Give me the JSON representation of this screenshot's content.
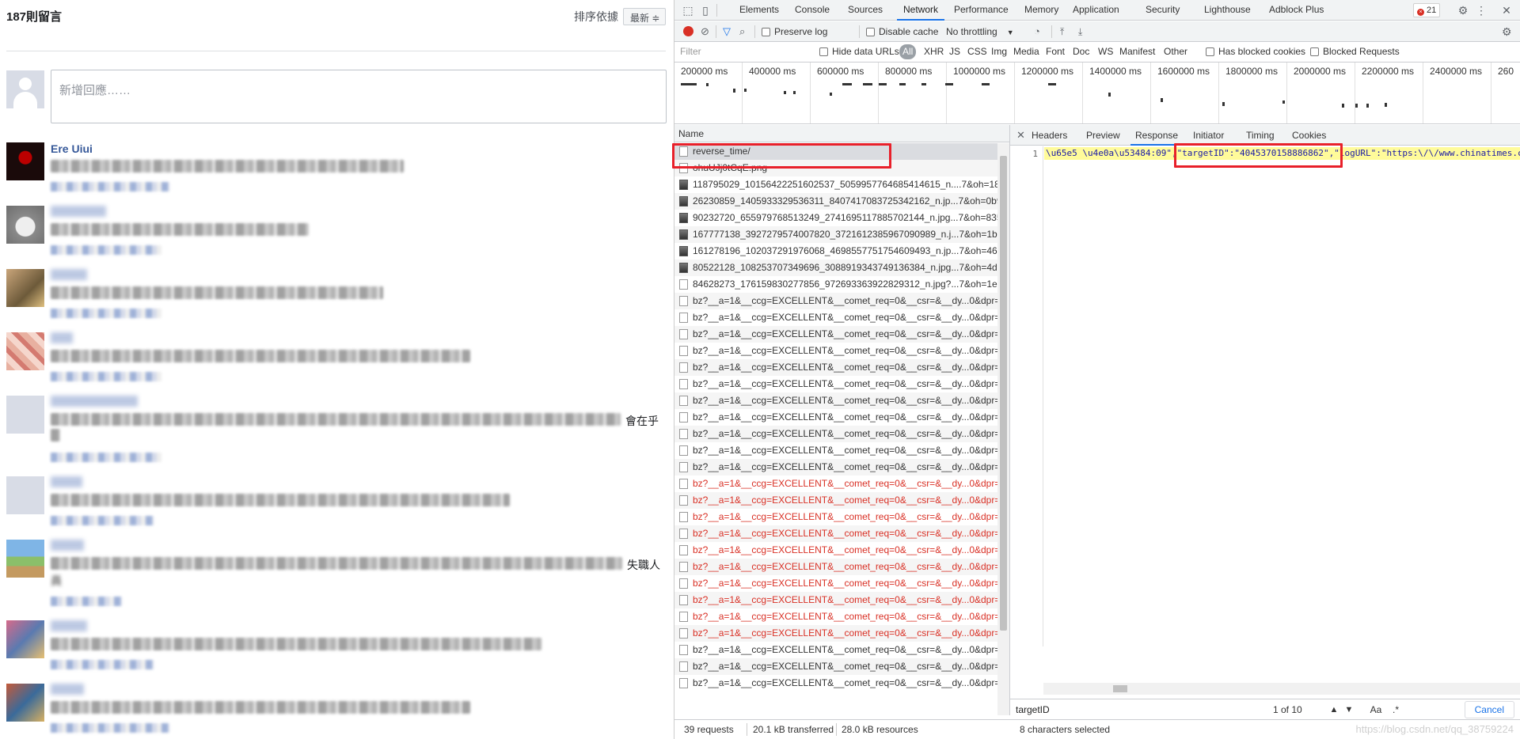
{
  "comments_panel": {
    "count_label": "187則留言",
    "sort_label": "排序依據",
    "sort_value": "最新 ≑",
    "input_placeholder": "新增回應……",
    "first_commenter": "Ere Uiui",
    "tail_text_1": "會在乎",
    "tail_text_2": "失職人",
    "tail_text_3": "員"
  },
  "devtools": {
    "tabs": [
      "Elements",
      "Console",
      "Sources",
      "Network",
      "Performance",
      "Memory",
      "Application",
      "Security",
      "Lighthouse",
      "Adblock Plus"
    ],
    "active_tab": "Network",
    "error_count": "21",
    "toolbar": {
      "preserve_log": "Preserve log",
      "disable_cache": "Disable cache",
      "throttling": "No throttling"
    },
    "filter": {
      "placeholder": "Filter",
      "hide_data_urls": "Hide data URLs",
      "types": [
        "All",
        "XHR",
        "JS",
        "CSS",
        "Img",
        "Media",
        "Font",
        "Doc",
        "WS",
        "Manifest",
        "Other"
      ],
      "has_blocked_cookies": "Has blocked cookies",
      "blocked_requests": "Blocked Requests"
    },
    "overview_labels": [
      "200000 ms",
      "400000 ms",
      "600000 ms",
      "800000 ms",
      "1000000 ms",
      "1200000 ms",
      "1400000 ms",
      "1600000 ms",
      "1800000 ms",
      "2000000 ms",
      "2200000 ms",
      "2400000 ms",
      "260"
    ],
    "names_header": "Name",
    "requests": [
      {
        "name": "reverse_time/",
        "kind": "doc",
        "status": "selected"
      },
      {
        "name": "ohuUJj0tCqE.png",
        "kind": "doc",
        "status": "normal"
      },
      {
        "name": "118795029_10156422251602537_5059957764685414615_n....7&oh=1891",
        "kind": "img",
        "status": "normal"
      },
      {
        "name": "26230859_1405933329536311_8407417083725342162_n.jp...7&oh=0b95",
        "kind": "img",
        "status": "normal"
      },
      {
        "name": "90232720_655979768513249_2741695117885702144_n.jpg...7&oh=8359",
        "kind": "img",
        "status": "normal"
      },
      {
        "name": "167777138_3927279574007820_3721612385967090989_n.j...7&oh=1b20",
        "kind": "img",
        "status": "normal"
      },
      {
        "name": "161278196_102037291976068_4698557751754609493_n.jp...7&oh=4628",
        "kind": "img",
        "status": "normal"
      },
      {
        "name": "80522128_108253707349696_3088919343749136384_n.jpg...7&oh=4dfa",
        "kind": "img",
        "status": "normal"
      },
      {
        "name": "84628273_176159830277856_972693363922829312_n.jpg?...7&oh=1e51",
        "kind": "doc",
        "status": "normal"
      },
      {
        "name": "bz?__a=1&__ccg=EXCELLENT&__comet_req=0&__csr=&__dy...0&dpr=1&",
        "kind": "doc",
        "status": "normal"
      },
      {
        "name": "bz?__a=1&__ccg=EXCELLENT&__comet_req=0&__csr=&__dy...0&dpr=1&",
        "kind": "doc",
        "status": "normal"
      },
      {
        "name": "bz?__a=1&__ccg=EXCELLENT&__comet_req=0&__csr=&__dy...0&dpr=1&",
        "kind": "doc",
        "status": "normal"
      },
      {
        "name": "bz?__a=1&__ccg=EXCELLENT&__comet_req=0&__csr=&__dy...0&dpr=1&",
        "kind": "doc",
        "status": "normal"
      },
      {
        "name": "bz?__a=1&__ccg=EXCELLENT&__comet_req=0&__csr=&__dy...0&dpr=1&",
        "kind": "doc",
        "status": "normal"
      },
      {
        "name": "bz?__a=1&__ccg=EXCELLENT&__comet_req=0&__csr=&__dy...0&dpr=1&",
        "kind": "doc",
        "status": "normal"
      },
      {
        "name": "bz?__a=1&__ccg=EXCELLENT&__comet_req=0&__csr=&__dy...0&dpr=1&",
        "kind": "doc",
        "status": "normal"
      },
      {
        "name": "bz?__a=1&__ccg=EXCELLENT&__comet_req=0&__csr=&__dy...0&dpr=1&",
        "kind": "doc",
        "status": "normal"
      },
      {
        "name": "bz?__a=1&__ccg=EXCELLENT&__comet_req=0&__csr=&__dy...0&dpr=1&",
        "kind": "doc",
        "status": "normal"
      },
      {
        "name": "bz?__a=1&__ccg=EXCELLENT&__comet_req=0&__csr=&__dy...0&dpr=1&",
        "kind": "doc",
        "status": "normal"
      },
      {
        "name": "bz?__a=1&__ccg=EXCELLENT&__comet_req=0&__csr=&__dy...0&dpr=1&",
        "kind": "doc",
        "status": "normal"
      },
      {
        "name": "bz?__a=1&__ccg=EXCELLENT&__comet_req=0&__csr=&__dy...0&dpr=1&",
        "kind": "doc",
        "status": "error"
      },
      {
        "name": "bz?__a=1&__ccg=EXCELLENT&__comet_req=0&__csr=&__dy...0&dpr=1&",
        "kind": "doc",
        "status": "error"
      },
      {
        "name": "bz?__a=1&__ccg=EXCELLENT&__comet_req=0&__csr=&__dy...0&dpr=1&",
        "kind": "doc",
        "status": "error"
      },
      {
        "name": "bz?__a=1&__ccg=EXCELLENT&__comet_req=0&__csr=&__dy...0&dpr=1&",
        "kind": "doc",
        "status": "error"
      },
      {
        "name": "bz?__a=1&__ccg=EXCELLENT&__comet_req=0&__csr=&__dy...0&dpr=1&",
        "kind": "doc",
        "status": "error"
      },
      {
        "name": "bz?__a=1&__ccg=EXCELLENT&__comet_req=0&__csr=&__dy...0&dpr=1&",
        "kind": "doc",
        "status": "error"
      },
      {
        "name": "bz?__a=1&__ccg=EXCELLENT&__comet_req=0&__csr=&__dy...0&dpr=1&",
        "kind": "doc",
        "status": "error"
      },
      {
        "name": "bz?__a=1&__ccg=EXCELLENT&__comet_req=0&__csr=&__dy...0&dpr=1&",
        "kind": "doc",
        "status": "error"
      },
      {
        "name": "bz?__a=1&__ccg=EXCELLENT&__comet_req=0&__csr=&__dy...0&dpr=1&",
        "kind": "doc",
        "status": "error"
      },
      {
        "name": "bz?__a=1&__ccg=EXCELLENT&__comet_req=0&__csr=&__dy...0&dpr=1&",
        "kind": "doc",
        "status": "error"
      },
      {
        "name": "bz?__a=1&__ccg=EXCELLENT&__comet_req=0&__csr=&__dy...0&dpr=1&",
        "kind": "doc",
        "status": "normal"
      },
      {
        "name": "bz?__a=1&__ccg=EXCELLENT&__comet_req=0&__csr=&__dy...0&dpr=1&",
        "kind": "doc",
        "status": "normal"
      },
      {
        "name": "bz?__a=1&__ccg=EXCELLENT&__comet_req=0&__csr=&__dy...0&dpr=1&",
        "kind": "doc",
        "status": "normal"
      }
    ],
    "detail_tabs": [
      "Headers",
      "Preview",
      "Response",
      "Initiator",
      "Timing",
      "Cookies"
    ],
    "active_detail_tab": "Response",
    "response_line_number": "1",
    "response_code": "\\u65e5 \\u4e0a\\u53484:09\",\"targetID\":\"4045370158886862\",\"logURL\":\"https:\\/\\/www.chinatimes.c",
    "search": {
      "query": "targetID",
      "match_count": "1 of 10",
      "match_case": "Aa",
      "regex": ".*",
      "cancel": "Cancel"
    },
    "status": {
      "requests": "39 requests",
      "transferred": "20.1 kB transferred",
      "resources": "28.0 kB resources",
      "selection": "8 characters selected"
    },
    "watermark": "https://blog.csdn.net/qq_38759224"
  },
  "colors": {
    "accent": "#1a73e8",
    "error": "#d93025",
    "highlight_box": "#e8202a",
    "link_name": "#365899"
  }
}
